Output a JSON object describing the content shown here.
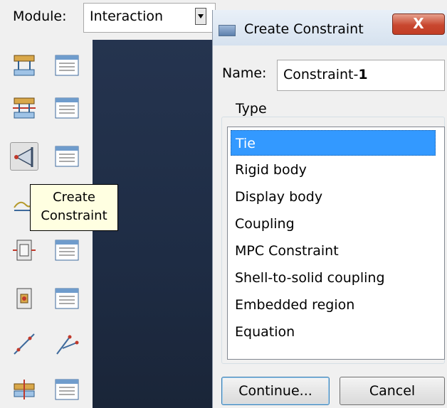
{
  "module": {
    "label": "Module:",
    "value": "Interaction"
  },
  "toolbox": {
    "icons": [
      "create-interaction-icon",
      "interaction-manager-icon",
      "create-interaction-property-icon",
      "interaction-property-manager-icon",
      "create-constraint-icon",
      "constraint-manager-icon",
      "create-connector-section-icon",
      "create-wire-icon",
      "connector-manager-icon",
      "create-fastener-icon",
      "fastener-manager-icon",
      "create-attachment-line-icon",
      "create-attachment-points-icon",
      "create-amplitude-icon",
      "amplitude-manager-icon"
    ]
  },
  "tooltip": {
    "line1": "Create",
    "line2": "Constraint"
  },
  "dialog": {
    "title": "Create Constraint",
    "close_label": "X",
    "name_label": "Name:",
    "name_value_prefix": "Constraint-",
    "name_value_suffix": "1",
    "type_label": "Type",
    "types": [
      "Tie",
      "Rigid body",
      "Display body",
      "Coupling",
      "MPC Constraint",
      "Shell-to-solid coupling",
      "Embedded region",
      "Equation"
    ],
    "selected_type": "Tie",
    "continue_label": "Continue...",
    "cancel_label": "Cancel"
  },
  "colors": {
    "selection": "#3399ff",
    "viewport": "#1e2c44",
    "tooltip_bg": "#ffffe1",
    "close_red": "#c8472f"
  }
}
